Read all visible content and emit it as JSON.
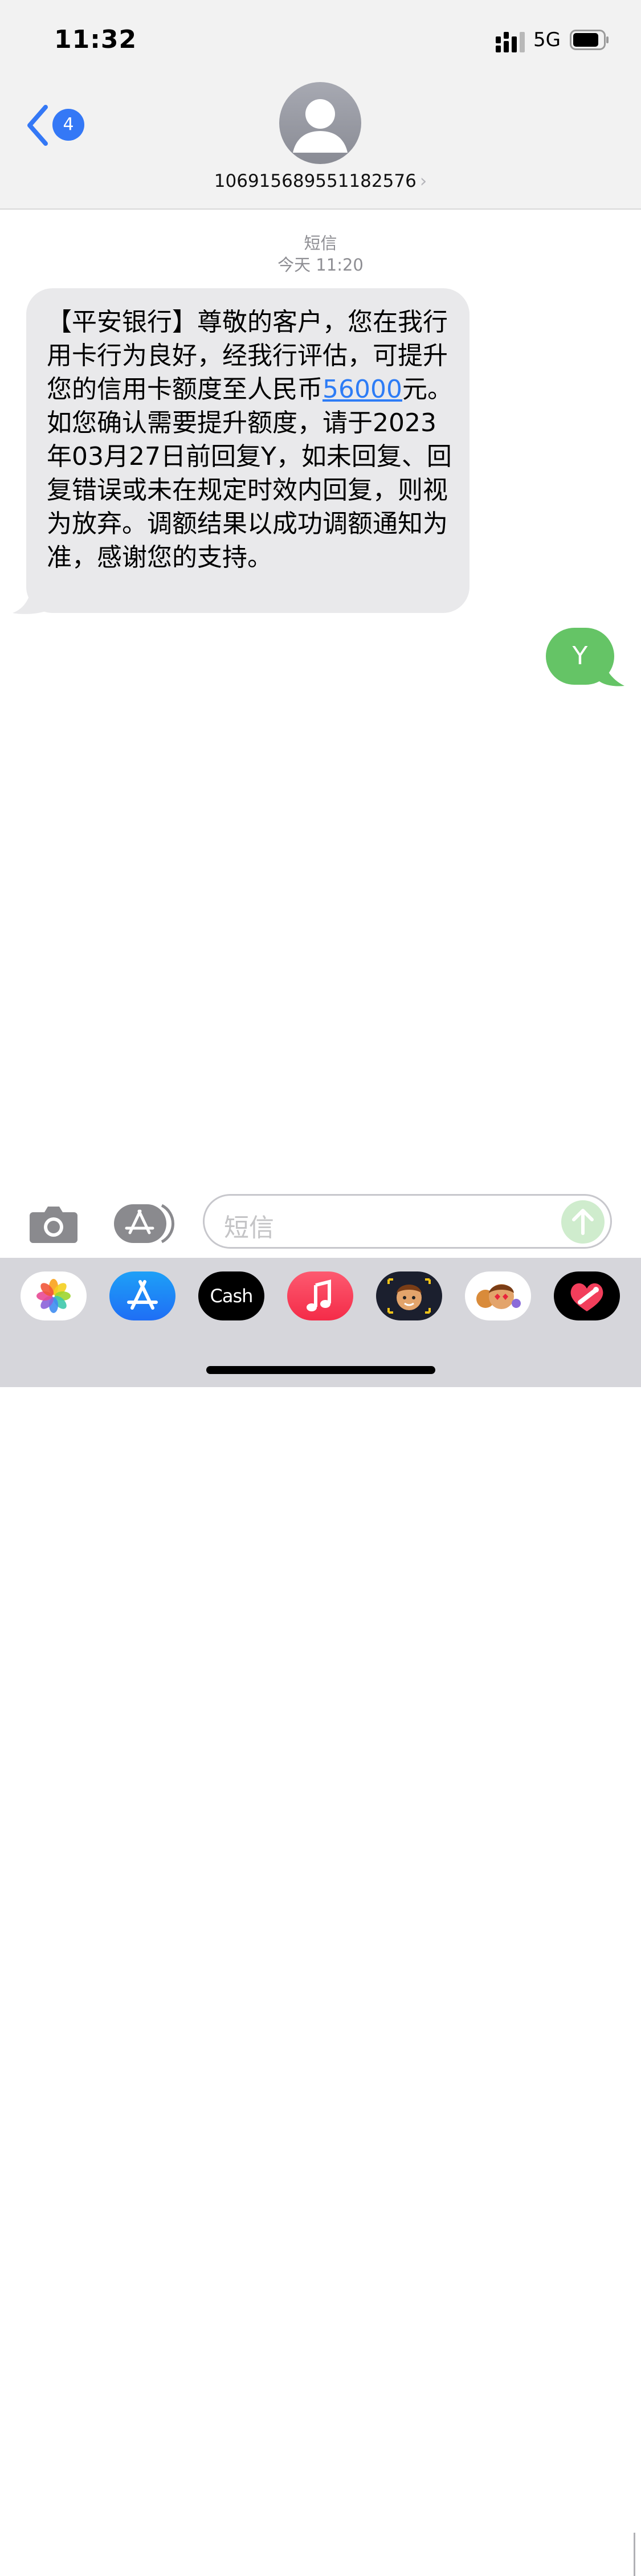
{
  "status_bar": {
    "time": "11:32",
    "network": "5G"
  },
  "header": {
    "back_badge": "4",
    "contact": "106915689551182576",
    "contact_chevron": "›"
  },
  "thread": {
    "service_label": "短信",
    "timestamp": "今天 11:20"
  },
  "messages": {
    "incoming": {
      "text_before_link": "【平安银行】尊敬的客户，您在我行用卡行为良好，经我行评估，可提升您的信用卡额度至人民币",
      "link": "56000",
      "text_after_link": "元。如您确认需要提升额度，请于2023年03月27日前回复Y，如未回复、回复错误或未在规定时效内回复，则视为放弃。调额结果以成功调额通知为准，感谢您的支持。"
    },
    "outgoing": {
      "text": "Y"
    }
  },
  "input": {
    "placeholder": "短信"
  },
  "app_tray": {
    "cash_label": "Cash",
    "items": [
      "photos-icon",
      "app-store-icon",
      "apple-cash-icon",
      "music-icon",
      "memoji-icon",
      "memoji-stickers-icon",
      "digital-touch-icon"
    ]
  },
  "colors": {
    "accent": "#3478f6",
    "incoming_bubble": "#e9e9eb",
    "outgoing_bubble": "#65c466",
    "link": "#2d7cf6",
    "header_bg": "#f2f2f2",
    "tray_bg": "#d6d6db"
  }
}
